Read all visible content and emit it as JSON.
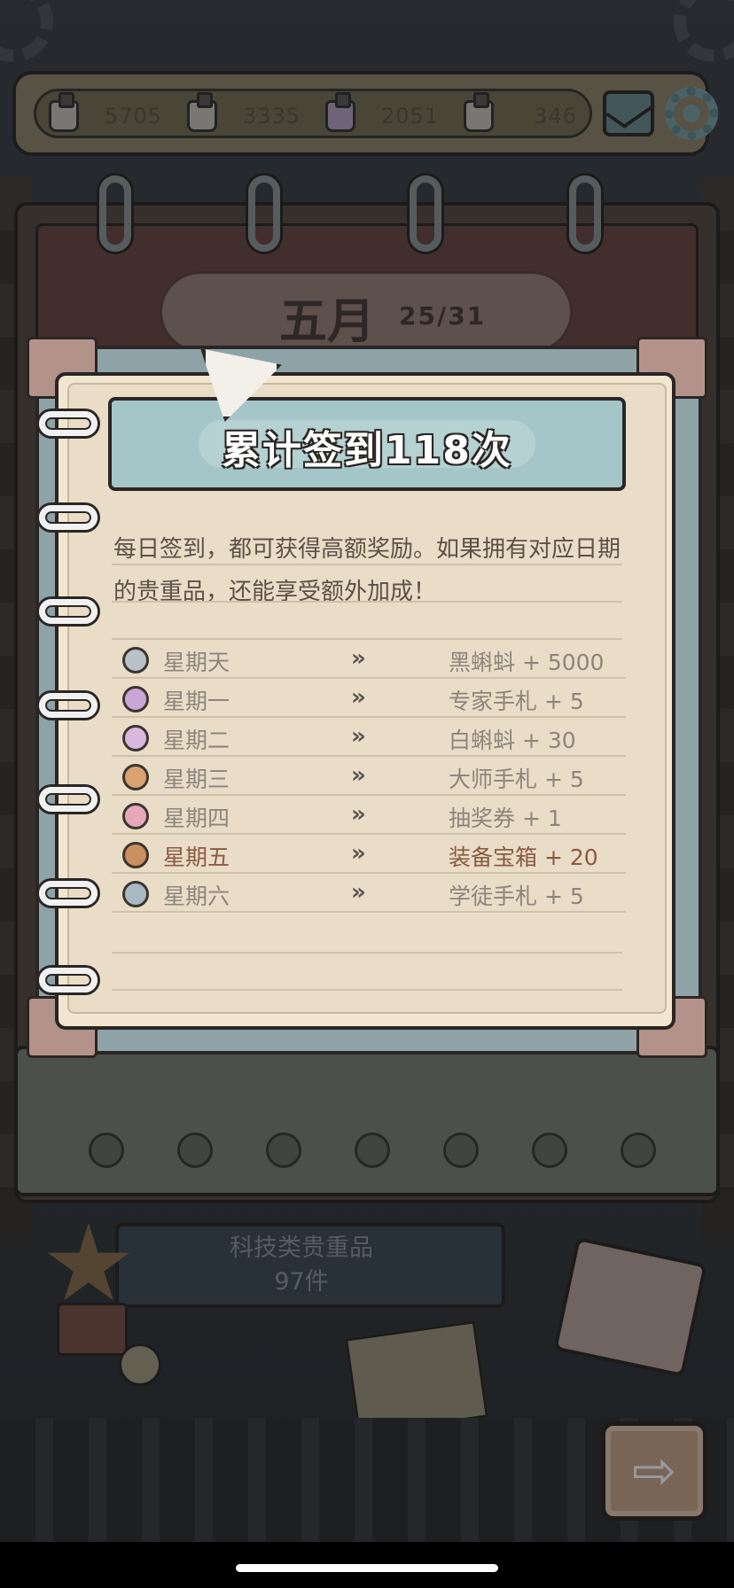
{
  "resources": [
    {
      "icon": "resource-crate-icon",
      "value": "5705",
      "color": "#c9c5bd"
    },
    {
      "icon": "resource-crate-icon",
      "value": "3335",
      "color": "#c9c5bd"
    },
    {
      "icon": "resource-crate-purple-icon",
      "value": "2051",
      "color": "#b8a3c4"
    },
    {
      "icon": "resource-crate-icon",
      "value": "346",
      "color": "#c9c5bd"
    }
  ],
  "calendar": {
    "month": "五月",
    "progress": "25/31"
  },
  "modal": {
    "title": "累计签到118次",
    "description": "每日签到，都可获得高额奖励。如果拥有对应日期的贵重品，还能享受额外加成！",
    "rewards": [
      {
        "day": "星期天",
        "reward": "黑蝌蚪 + 5000",
        "icon_color": "#b8c0c8",
        "current": false
      },
      {
        "day": "星期一",
        "reward": "专家手札 + 5",
        "icon_color": "#c9a6d6",
        "current": false
      },
      {
        "day": "星期二",
        "reward": "白蝌蚪 + 30",
        "icon_color": "#d9b8e0",
        "current": false
      },
      {
        "day": "星期三",
        "reward": "大师手札 + 5",
        "icon_color": "#d9a26e",
        "current": false
      },
      {
        "day": "星期四",
        "reward": "抽奖券 + 1",
        "icon_color": "#e7a9b8",
        "current": false
      },
      {
        "day": "星期五",
        "reward": "装备宝箱 + 20",
        "icon_color": "#c98f5e",
        "current": true
      },
      {
        "day": "星期六",
        "reward": "学徒手札 + 5",
        "icon_color": "#aab8c4",
        "current": false
      }
    ]
  },
  "plaque": {
    "title": "科技类贵重品",
    "count": "97件"
  },
  "colors": {
    "accent_banner": "#a5c6c8",
    "paper": "#f2e6d0",
    "current_day_text": "#8a5a42"
  },
  "next_button_glyph": "⇨"
}
